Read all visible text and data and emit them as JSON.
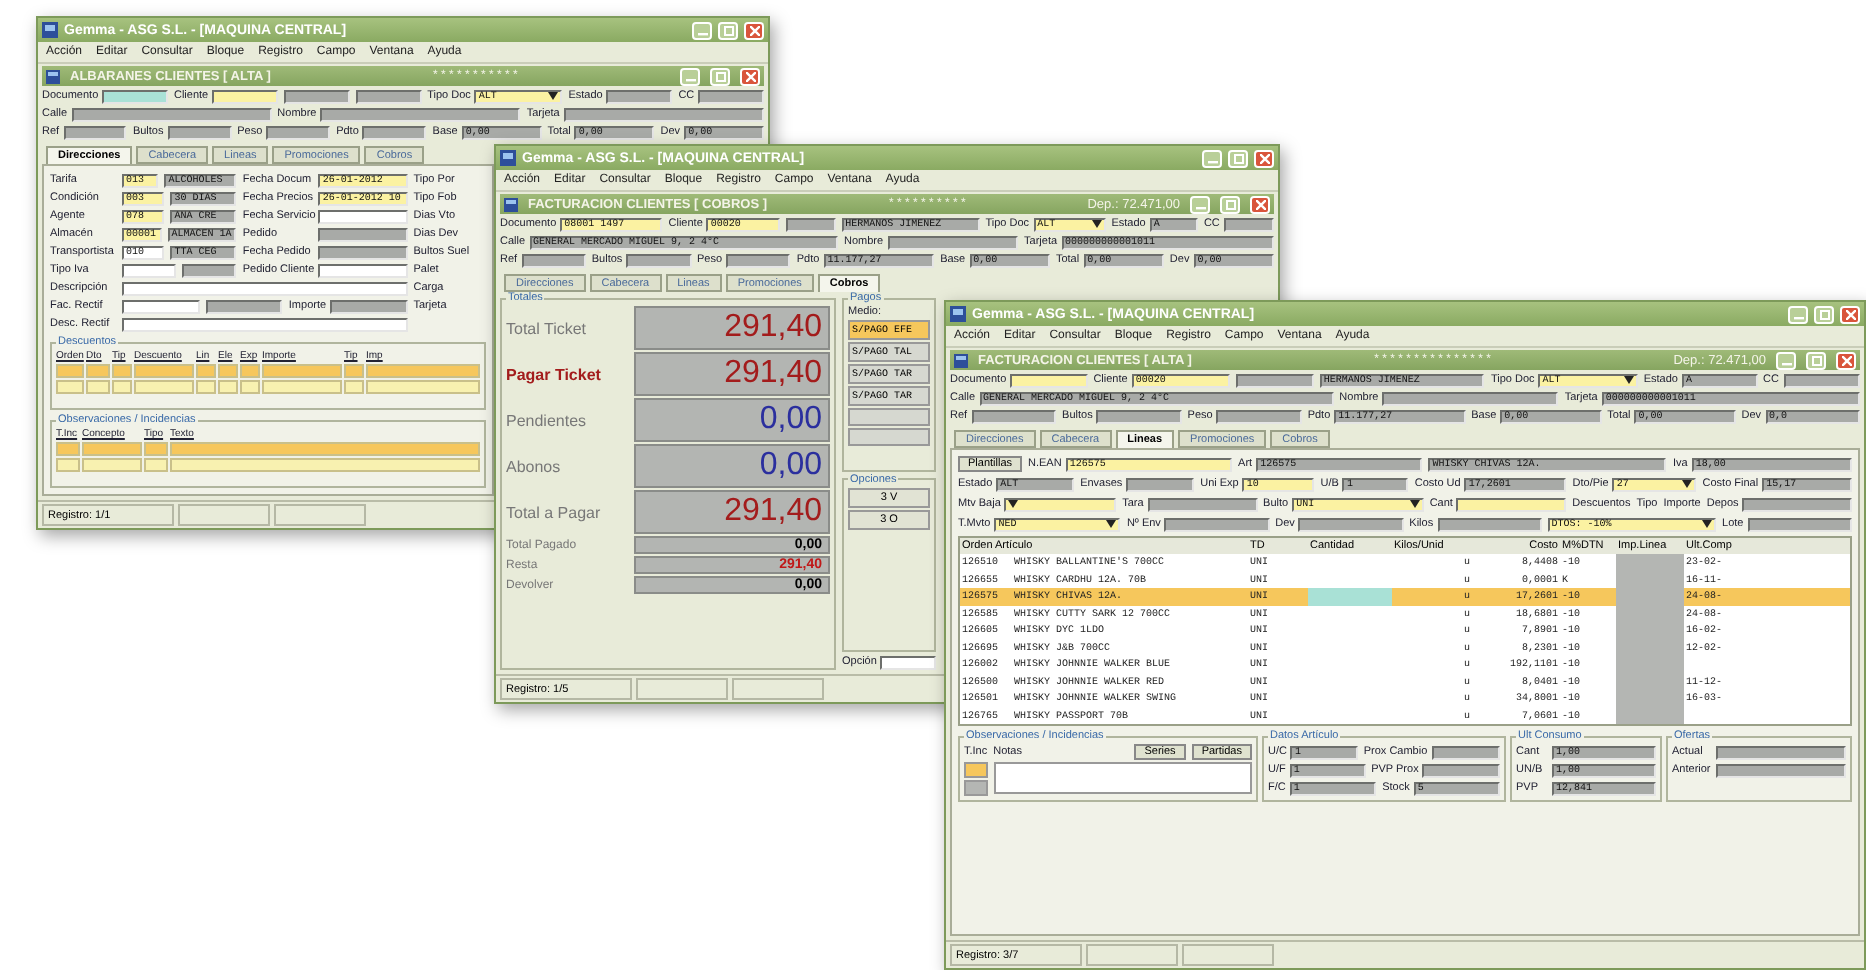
{
  "windows": [
    {
      "kind": "albaran",
      "title": "Gemma - ASG S.L. - [MAQUINA CENTRAL]",
      "menu": [
        "Acción",
        "Editar",
        "Consultar",
        "Bloque",
        "Registro",
        "Campo",
        "Ventana",
        "Ayuda"
      ],
      "subtitle": "ALBARANES CLIENTES [ ALTA ]",
      "stars": "* * * * * * * * * * *",
      "header": [
        [
          {
            "label": "Documento",
            "kind": "active"
          },
          {
            "label": "Cliente",
            "kind": "edit"
          },
          {
            "kind": "view"
          },
          {
            "kind": "view"
          },
          {
            "label": "Tipo Doc",
            "value": "ALT",
            "kind": "select"
          },
          {
            "label": "Estado",
            "kind": "view"
          },
          {
            "label": "CC",
            "kind": "view"
          }
        ],
        [
          {
            "label": "Calle",
            "kind": "view"
          },
          {
            "label": "Nombre",
            "kind": "view"
          },
          {
            "label": "Tarjeta",
            "kind": "view"
          }
        ],
        [
          {
            "label": "Ref",
            "kind": "view"
          },
          {
            "label": "Bultos",
            "kind": "view"
          },
          {
            "label": "Peso",
            "kind": "view"
          },
          {
            "label": "Pdto",
            "kind": "view"
          },
          {
            "label": "Base",
            "value": "0,00",
            "kind": "view"
          },
          {
            "label": "Total",
            "value": "0,00",
            "kind": "view"
          },
          {
            "label": "Dev",
            "value": "0,00",
            "kind": "view"
          }
        ]
      ],
      "tabs": [
        {
          "label": "Direcciones",
          "selected": true
        },
        {
          "label": "Cabecera",
          "selected": false
        },
        {
          "label": "Lineas",
          "selected": false
        },
        {
          "label": "Promociones",
          "selected": false
        },
        {
          "label": "Cobros",
          "selected": false
        }
      ],
      "left": [
        [
          {
            "label": "Tarifa",
            "value": "013",
            "kind": "edit"
          },
          {
            "value": "ALCOHOLES",
            "kind": "view"
          }
        ],
        [
          {
            "label": "Condición",
            "value": "003",
            "kind": "edit"
          },
          {
            "value": "30 DIAS",
            "kind": "view"
          }
        ],
        [
          {
            "label": "Agente",
            "value": "078",
            "kind": "edit"
          },
          {
            "value": "ANA CRE",
            "kind": "view"
          }
        ],
        [
          {
            "label": "Almacén",
            "value": "00001",
            "kind": "edit"
          },
          {
            "value": "ALMACEN 1A",
            "kind": "view"
          }
        ],
        [
          {
            "label": "Transportista",
            "value": "010",
            "kind": "blank"
          },
          {
            "value": "TTA CEG",
            "kind": "view"
          }
        ],
        [
          {
            "label": "Tipo Iva",
            "kind": "blank"
          },
          {
            "kind": "view"
          }
        ]
      ],
      "middle": [
        [
          {
            "label": "Fecha Docum",
            "value": "26-01-2012",
            "kind": "edit"
          }
        ],
        [
          {
            "label": "Fecha Precios",
            "value": "26-01-2012 10",
            "kind": "edit"
          }
        ],
        [
          {
            "label": "Fecha Servicio",
            "kind": "blank"
          }
        ],
        [
          {
            "label": "Pedido",
            "kind": "view"
          }
        ],
        [
          {
            "label": "Fecha Pedido",
            "kind": "view"
          }
        ],
        [
          {
            "label": "Pedido Cliente",
            "kind": "blank"
          }
        ]
      ],
      "right": [
        "Tipo Por",
        "Tipo Fob",
        "Dias Vto",
        "Dias Dev",
        "Bultos Suel",
        "Palet",
        "Carga",
        "Tarjeta"
      ],
      "wide": [
        [
          {
            "label": "Descripción",
            "kind": "blank"
          }
        ],
        [
          {
            "label": "Fac. Rectif",
            "kind": "blank"
          },
          {
            "kind": "view"
          },
          {
            "label": "Importe",
            "kind": "view"
          }
        ],
        [
          {
            "label": "Desc. Rectif",
            "kind": "blank"
          }
        ]
      ],
      "grids": [
        {
          "title": "Descuentos",
          "columns": [
            "Orden",
            "Dto",
            "Tip",
            "Descuento",
            "Lin",
            "Ele",
            "Exp",
            "Importe",
            "Tip",
            "Imp"
          ],
          "rows": [
            {
              "selected": true
            },
            {
              "selected": false
            }
          ]
        },
        {
          "title": "Observaciones / Incidencias",
          "columns": [
            "T.Inc",
            "Concepto",
            "Tipo",
            "Texto"
          ],
          "rows": [
            {
              "selected": true
            },
            {
              "selected": false
            }
          ]
        }
      ],
      "status": "Registro: 1/1"
    },
    {
      "kind": "cobros",
      "title": "Gemma - ASG S.L. - [MAQUINA CENTRAL]",
      "menu": [
        "Acción",
        "Editar",
        "Consultar",
        "Bloque",
        "Registro",
        "Campo",
        "Ventana",
        "Ayuda"
      ],
      "subtitle": "FACTURACION CLIENTES [ COBROS ]",
      "stars": "* * * * * * * * * *",
      "deposit": "Dep.: 72.471,00",
      "header": [
        [
          {
            "label": "Documento",
            "value": "08001 1497",
            "kind": "edit"
          },
          {
            "label": "Cliente",
            "value": "00020",
            "kind": "edit"
          },
          {
            "kind": "view"
          },
          {
            "value": "HERMANOS JIMENEZ",
            "kind": "view"
          },
          {
            "label": "Tipo Doc",
            "value": "ALT",
            "kind": "select"
          },
          {
            "label": "Estado",
            "value": "A",
            "kind": "view"
          },
          {
            "label": "CC",
            "kind": "view"
          }
        ],
        [
          {
            "label": "Calle",
            "value": "GENERAL MERCADO MIGUEL 9, 2 4°C",
            "kind": "view"
          },
          {
            "label": "Nombre",
            "kind": "view"
          },
          {
            "label": "Tarjeta",
            "value": "000000000001011",
            "kind": "view"
          }
        ],
        [
          {
            "label": "Ref",
            "kind": "view"
          },
          {
            "label": "Bultos",
            "kind": "view"
          },
          {
            "label": "Peso",
            "kind": "view"
          },
          {
            "label": "Pdto",
            "value": "11.177,27",
            "kind": "view"
          },
          {
            "label": "Base",
            "value": "0,00",
            "kind": "view"
          },
          {
            "label": "Total",
            "value": "0,00",
            "kind": "view"
          },
          {
            "label": "Dev",
            "value": "0,00",
            "kind": "view"
          }
        ]
      ],
      "tabs": [
        {
          "label": "Direcciones",
          "selected": false
        },
        {
          "label": "Cabecera",
          "selected": false
        },
        {
          "label": "Lineas",
          "selected": false
        },
        {
          "label": "Promociones",
          "selected": false
        },
        {
          "label": "Cobros",
          "selected": true
        }
      ],
      "totales": {
        "title": "Totales",
        "rows": [
          {
            "label": "Total Ticket",
            "value": "291,40",
            "color": "#a31c1c",
            "highlight": false
          },
          {
            "label": "Pagar Ticket",
            "value": "291,40",
            "color": "#a31c1c",
            "highlight": true
          },
          {
            "label": "Pendientes",
            "value": "0,00",
            "color": "#2b2f9e",
            "highlight": false
          },
          {
            "label": "Abonos",
            "value": "0,00",
            "color": "#2b2f9e",
            "highlight": false
          },
          {
            "label": "Total a Pagar",
            "value": "291,40",
            "color": "#a31c1c",
            "highlight": false
          }
        ],
        "small": [
          {
            "label": "Total Pagado",
            "value": "0,00",
            "color": "#000000"
          },
          {
            "label": "Resta",
            "value": "291,40",
            "color": "#c01818"
          },
          {
            "label": "Devolver",
            "value": "0,00",
            "color": "#000000"
          }
        ]
      },
      "pagos": {
        "title": "Pagos",
        "header": "Medio:",
        "items": [
          {
            "label": "S/PAGO EFE",
            "selected": true
          },
          {
            "label": "S/PAGO TAL",
            "selected": false
          },
          {
            "label": "S/PAGO TAR",
            "selected": false
          },
          {
            "label": "S/PAGO TAR",
            "selected": false
          }
        ]
      },
      "opciones": {
        "title": "Opciones",
        "buttons": [
          "3 V",
          "3 O"
        ],
        "field_label": "Opción"
      },
      "status": "Registro: 1/5"
    },
    {
      "kind": "lineas",
      "title": "Gemma - ASG S.L. - [MAQUINA CENTRAL]",
      "menu": [
        "Acción",
        "Editar",
        "Consultar",
        "Bloque",
        "Registro",
        "Campo",
        "Ventana",
        "Ayuda"
      ],
      "subtitle": "FACTURACION CLIENTES [ ALTA ]",
      "stars": "* * * * * * * * * * * * * * *",
      "deposit": "Dep.: 72.471,00",
      "header": [
        [
          {
            "label": "Documento",
            "kind": "edit"
          },
          {
            "label": "Cliente",
            "value": "00020",
            "kind": "edit"
          },
          {
            "kind": "view"
          },
          {
            "value": "HERMANOS JIMENEZ",
            "kind": "view"
          },
          {
            "label": "Tipo Doc",
            "value": "ALT",
            "kind": "select"
          },
          {
            "label": "Estado",
            "value": "A",
            "kind": "view"
          },
          {
            "label": "CC",
            "kind": "view"
          }
        ],
        [
          {
            "label": "Calle",
            "value": "GENERAL MERCADO MIGUEL 9, 2 4°C",
            "kind": "view"
          },
          {
            "label": "Nombre",
            "kind": "view"
          },
          {
            "label": "Tarjeta",
            "value": "000000000001011",
            "kind": "view"
          }
        ],
        [
          {
            "label": "Ref",
            "kind": "view"
          },
          {
            "label": "Bultos",
            "kind": "view"
          },
          {
            "label": "Peso",
            "kind": "view"
          },
          {
            "label": "Pdto",
            "value": "11.177,27",
            "kind": "view"
          },
          {
            "label": "Base",
            "value": "0,00",
            "kind": "view"
          },
          {
            "label": "Total",
            "value": "0,00",
            "kind": "view"
          },
          {
            "label": "Dev",
            "value": "0,0",
            "kind": "view"
          }
        ]
      ],
      "tabs": [
        {
          "label": "Direcciones",
          "selected": false
        },
        {
          "label": "Cabecera",
          "selected": false
        },
        {
          "label": "Lineas",
          "selected": true
        },
        {
          "label": "Promociones",
          "selected": false
        },
        {
          "label": "Cobros",
          "selected": false
        }
      ],
      "editor": [
        [
          {
            "value": "Plantillas",
            "kind": "button"
          },
          {
            "label": "N.EAN",
            "value": "126575",
            "kind": "edit"
          },
          {
            "label": "Art",
            "value": "126575",
            "kind": "view"
          },
          {
            "value": "WHISKY CHIVAS 12A.",
            "kind": "view"
          },
          {
            "label": "Iva",
            "value": "18,00",
            "kind": "view"
          }
        ],
        [
          {
            "label": "Estado",
            "value": "ALT",
            "kind": "view"
          },
          {
            "label": "Envases",
            "kind": "view"
          },
          {
            "label": "Uni Exp",
            "value": "10",
            "kind": "edit"
          },
          {
            "label": "U/B",
            "value": "1",
            "kind": "view"
          },
          {
            "label": "Costo Ud",
            "value": "17,2601",
            "kind": "view"
          },
          {
            "label": "Dto/Pie",
            "value": "27",
            "kind": "select"
          },
          {
            "label": "Costo Final",
            "value": "15,17",
            "kind": "view"
          }
        ],
        [
          {
            "label": "Mtv Baja",
            "kind": "select"
          },
          {
            "label": "Tara",
            "kind": "view"
          },
          {
            "label": "Bulto",
            "value": "UNI",
            "kind": "select"
          },
          {
            "label": "Cant",
            "kind": "edit"
          },
          {
            "label": "Descuentos",
            "kind": "label"
          },
          {
            "label": "Tipo",
            "kind": "label"
          },
          {
            "label": "Importe",
            "kind": "label"
          },
          {
            "label": "Depos",
            "kind": "view"
          }
        ],
        [
          {
            "label": "T.Mvto",
            "value": "NED",
            "kind": "select"
          },
          {
            "label": "Nº Env",
            "kind": "view"
          },
          {
            "label": "Dev",
            "kind": "view"
          },
          {
            "label": "Kilos",
            "kind": "view"
          },
          {
            "value": "DTOS: -10%",
            "kind": "select"
          },
          {
            "label": "Lote",
            "kind": "view"
          }
        ]
      ],
      "table": {
        "columns": [
          "Orden Artículo",
          "TD",
          "Cantidad",
          "Kilos/Unid",
          "Costo",
          "M%DTN",
          "Imp.Linea",
          "Ult.Comp"
        ],
        "rows": [
          {
            "code": "126510",
            "article": "WHISKY BALLANTINE'S 700CC",
            "td": "UNI",
            "unit": "u",
            "cost": "8,4408",
            "dto": "-10",
            "last": "23-02-",
            "selected": false
          },
          {
            "code": "126655",
            "article": "WHISKY CARDHU 12A. 70B",
            "td": "UNI",
            "unit": "u",
            "cost": "0,0001",
            "dto": "K",
            "last": "16-11-",
            "selected": false
          },
          {
            "code": "126575",
            "article": "WHISKY CHIVAS 12A.",
            "td": "UNI",
            "unit": "u",
            "cost": "17,2601",
            "dto": "-10",
            "last": "24-08-",
            "selected": true
          },
          {
            "code": "126585",
            "article": "WHISKY CUTTY SARK 12 700CC",
            "td": "UNI",
            "unit": "u",
            "cost": "18,6801",
            "dto": "-10",
            "last": "24-08-",
            "selected": false
          },
          {
            "code": "126605",
            "article": "WHISKY DYC 1LDO",
            "td": "UNI",
            "unit": "u",
            "cost": "7,8901",
            "dto": "-10",
            "last": "16-02-",
            "selected": false
          },
          {
            "code": "126695",
            "article": "WHISKY J&B 700CC",
            "td": "UNI",
            "unit": "u",
            "cost": "8,2301",
            "dto": "-10",
            "last": "12-02-",
            "selected": false
          },
          {
            "code": "126002",
            "article": "WHISKY JOHNNIE WALKER BLUE",
            "td": "UNI",
            "unit": "u",
            "cost": "192,1101",
            "dto": "-10",
            "selected": false
          },
          {
            "code": "126500",
            "article": "WHISKY JOHNNIE WALKER RED",
            "td": "UNI",
            "unit": "u",
            "cost": "8,0401",
            "dto": "-10",
            "last": "11-12-",
            "selected": false
          },
          {
            "code": "126501",
            "article": "WHISKY JOHNNIE WALKER SWING",
            "td": "UNI",
            "unit": "u",
            "cost": "34,8001",
            "dto": "-10",
            "last": "16-03-",
            "selected": false
          },
          {
            "code": "126765",
            "article": "WHISKY PASSPORT 70B",
            "td": "UNI",
            "unit": "u",
            "cost": "7,0601",
            "dto": "-10",
            "selected": false
          }
        ]
      },
      "observaciones": {
        "title": "Observaciones / Incidencias",
        "inc_label": "T.Inc",
        "notes_label": "Notas",
        "buttons": [
          "Series",
          "Partidas"
        ],
        "rows": [
          {
            "selected": true
          },
          {
            "selected": false
          }
        ]
      },
      "datos": {
        "title": "Datos Artículo",
        "rows": [
          [
            {
              "label": "U/C",
              "value": "1",
              "kind": "view"
            },
            {
              "label": "Prox Cambio",
              "kind": "view"
            }
          ],
          [
            {
              "label": "U/F",
              "value": "1",
              "kind": "view"
            },
            {
              "label": "PVP Prox",
              "kind": "view"
            }
          ],
          [
            {
              "label": "F/C",
              "value": "1",
              "kind": "view"
            },
            {
              "label": "Stock",
              "value": "5",
              "kind": "view"
            }
          ]
        ]
      },
      "consumo": {
        "title": "Ult Consumo",
        "rows": [
          [
            {
              "label": "Cant",
              "value": "1,00",
              "kind": "view"
            }
          ],
          [
            {
              "label": "UN/B",
              "value": "1,00",
              "kind": "view"
            }
          ],
          [
            {
              "label": "PVP",
              "value": "12,841",
              "kind": "view"
            }
          ]
        ]
      },
      "ofertas": {
        "title": "Ofertas",
        "rows": [
          [
            {
              "label": "Actual",
              "kind": "view"
            }
          ],
          [
            {
              "label": "Anterior",
              "kind": "view"
            }
          ]
        ]
      },
      "status": "Registro: 3/7"
    }
  ]
}
